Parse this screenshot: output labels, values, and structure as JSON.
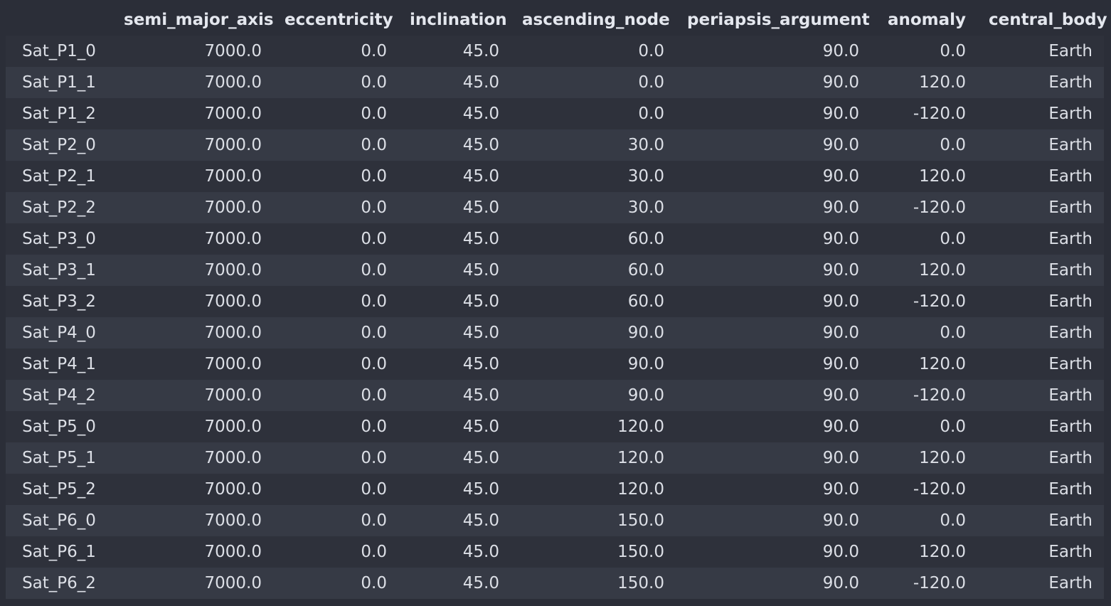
{
  "table": {
    "columns": [
      "",
      "semi_major_axis",
      "eccentricity",
      "inclination",
      "ascending_node",
      "periapsis_argument",
      "anomaly",
      "central_body"
    ],
    "rows": [
      [
        "Sat_P1_0",
        "7000.0",
        "0.0",
        "45.0",
        "0.0",
        "90.0",
        "0.0",
        "Earth"
      ],
      [
        "Sat_P1_1",
        "7000.0",
        "0.0",
        "45.0",
        "0.0",
        "90.0",
        "120.0",
        "Earth"
      ],
      [
        "Sat_P1_2",
        "7000.0",
        "0.0",
        "45.0",
        "0.0",
        "90.0",
        "-120.0",
        "Earth"
      ],
      [
        "Sat_P2_0",
        "7000.0",
        "0.0",
        "45.0",
        "30.0",
        "90.0",
        "0.0",
        "Earth"
      ],
      [
        "Sat_P2_1",
        "7000.0",
        "0.0",
        "45.0",
        "30.0",
        "90.0",
        "120.0",
        "Earth"
      ],
      [
        "Sat_P2_2",
        "7000.0",
        "0.0",
        "45.0",
        "30.0",
        "90.0",
        "-120.0",
        "Earth"
      ],
      [
        "Sat_P3_0",
        "7000.0",
        "0.0",
        "45.0",
        "60.0",
        "90.0",
        "0.0",
        "Earth"
      ],
      [
        "Sat_P3_1",
        "7000.0",
        "0.0",
        "45.0",
        "60.0",
        "90.0",
        "120.0",
        "Earth"
      ],
      [
        "Sat_P3_2",
        "7000.0",
        "0.0",
        "45.0",
        "60.0",
        "90.0",
        "-120.0",
        "Earth"
      ],
      [
        "Sat_P4_0",
        "7000.0",
        "0.0",
        "45.0",
        "90.0",
        "90.0",
        "0.0",
        "Earth"
      ],
      [
        "Sat_P4_1",
        "7000.0",
        "0.0",
        "45.0",
        "90.0",
        "90.0",
        "120.0",
        "Earth"
      ],
      [
        "Sat_P4_2",
        "7000.0",
        "0.0",
        "45.0",
        "90.0",
        "90.0",
        "-120.0",
        "Earth"
      ],
      [
        "Sat_P5_0",
        "7000.0",
        "0.0",
        "45.0",
        "120.0",
        "90.0",
        "0.0",
        "Earth"
      ],
      [
        "Sat_P5_1",
        "7000.0",
        "0.0",
        "45.0",
        "120.0",
        "90.0",
        "120.0",
        "Earth"
      ],
      [
        "Sat_P5_2",
        "7000.0",
        "0.0",
        "45.0",
        "120.0",
        "90.0",
        "-120.0",
        "Earth"
      ],
      [
        "Sat_P6_0",
        "7000.0",
        "0.0",
        "45.0",
        "150.0",
        "90.0",
        "0.0",
        "Earth"
      ],
      [
        "Sat_P6_1",
        "7000.0",
        "0.0",
        "45.0",
        "150.0",
        "90.0",
        "120.0",
        "Earth"
      ],
      [
        "Sat_P6_2",
        "7000.0",
        "0.0",
        "45.0",
        "150.0",
        "90.0",
        "-120.0",
        "Earth"
      ]
    ]
  }
}
